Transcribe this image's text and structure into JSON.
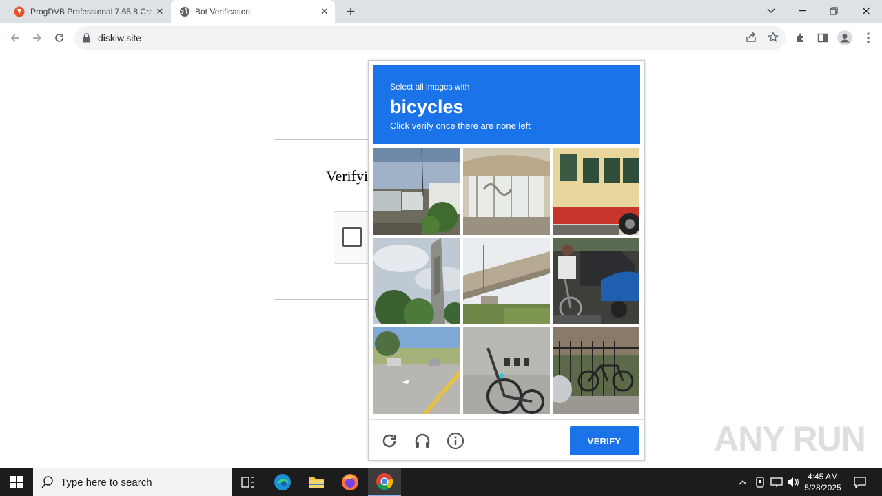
{
  "browser": {
    "tabs": [
      {
        "title": "ProgDVB Professional 7.65.8 Cra",
        "icon": "progdvb-favicon"
      },
      {
        "title": "Bot Verification",
        "icon": "globe-icon"
      }
    ],
    "url": "diskiw.site"
  },
  "page": {
    "heading": "Verifyi"
  },
  "captcha": {
    "instruction": "Select all images with",
    "target": "bicycles",
    "subtext": "Click verify once there are none left",
    "tiles": [
      "tile-1",
      "tile-2",
      "tile-3",
      "tile-4",
      "tile-5",
      "tile-6",
      "tile-7",
      "tile-8",
      "tile-9"
    ],
    "verify_label": "VERIFY",
    "accent_color": "#1a73e8"
  },
  "watermark": "ANY RUN",
  "taskbar": {
    "search_placeholder": "Type here to search",
    "time": "4:45 AM",
    "date": "5/28/2025"
  }
}
